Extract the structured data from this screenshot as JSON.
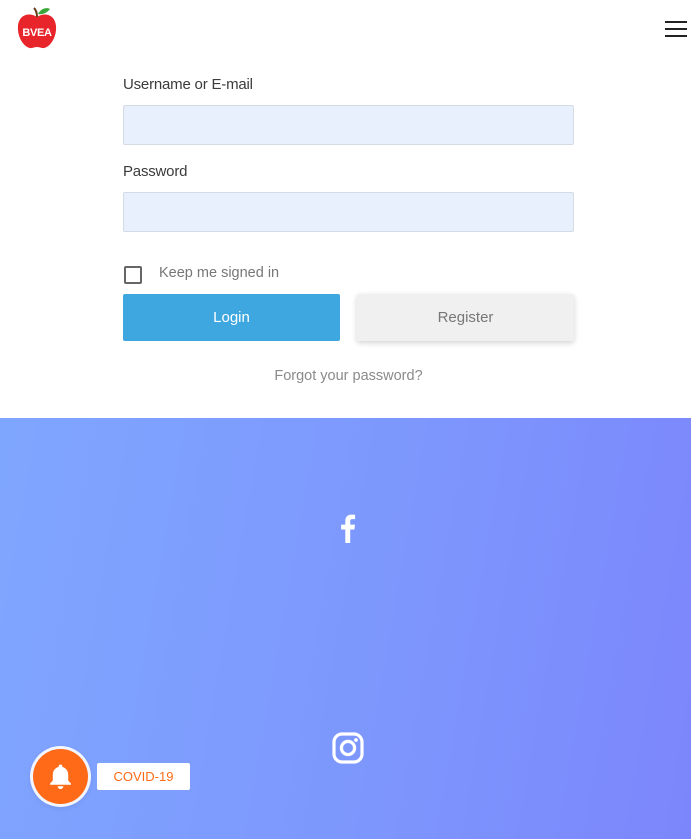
{
  "header": {
    "logo_text": "BVEA",
    "menu_icon": "hamburger-icon"
  },
  "login_form": {
    "username_label": "Username or E-mail",
    "username_value": "",
    "password_label": "Password",
    "password_value": "",
    "remember_label": "Keep me signed in",
    "remember_checked": false,
    "login_button": "Login",
    "register_button": "Register",
    "forgot_link": "Forgot your password?"
  },
  "footer": {
    "social": [
      {
        "icon": "facebook-icon"
      },
      {
        "icon": "instagram-icon"
      }
    ]
  },
  "notification": {
    "icon": "bell-icon",
    "badge_label": "COVID-19"
  },
  "colors": {
    "accent": "#3ea7e0",
    "logo_red": "#e8252b",
    "notify_orange": "#fe6a17",
    "footer_gradient_start": "#7fa6ff",
    "footer_gradient_end": "#7c86fc",
    "input_fill": "#e8f0fe"
  }
}
